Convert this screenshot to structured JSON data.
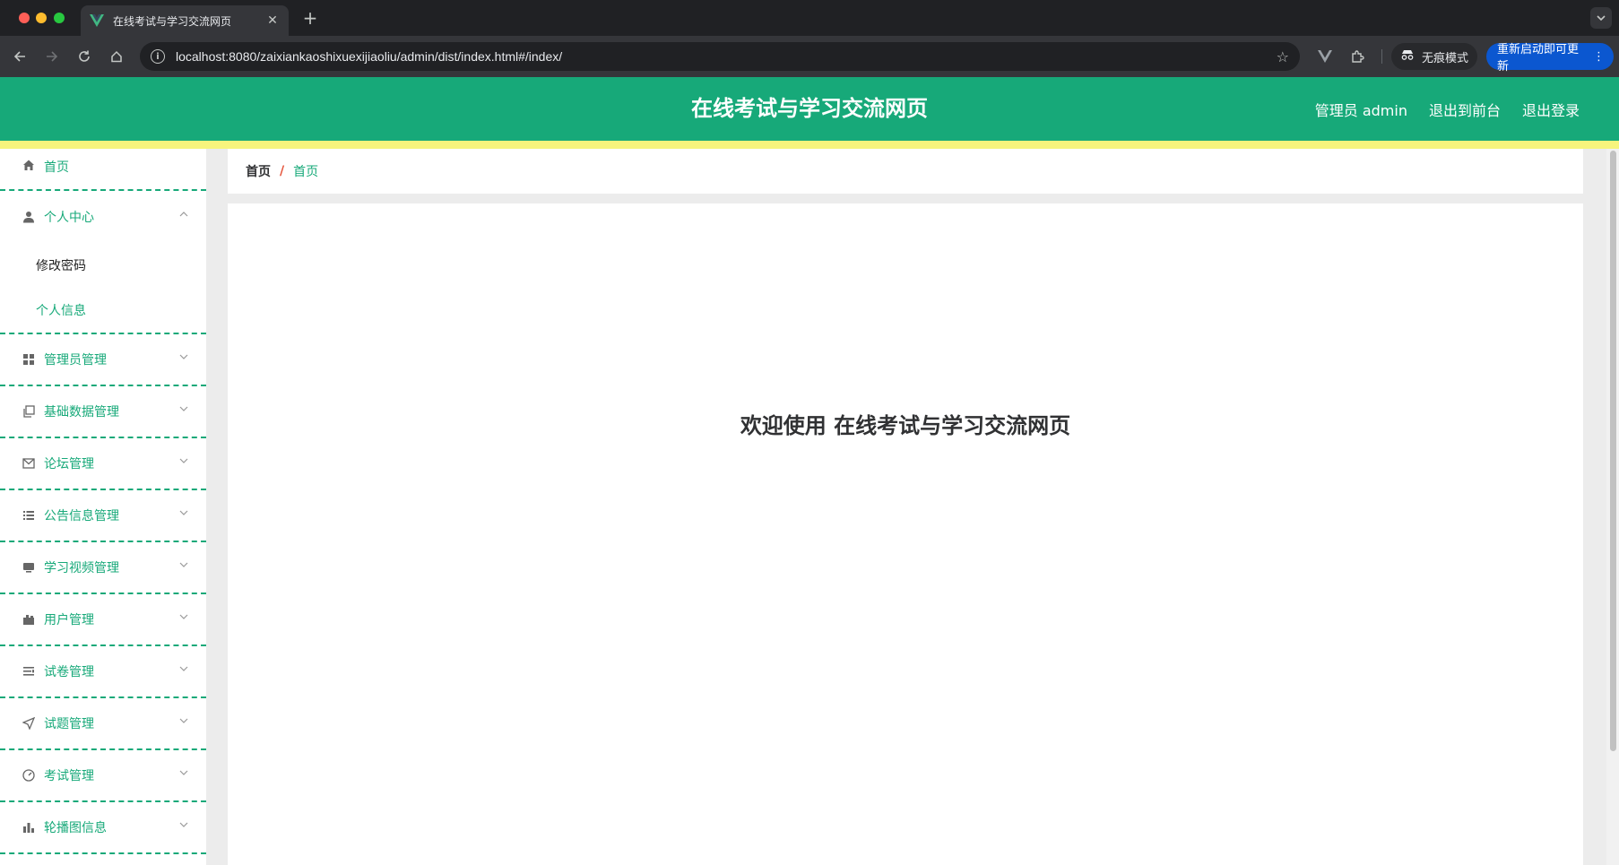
{
  "browser": {
    "tab_title": "在线考试与学习交流网页",
    "url": "localhost:8080/zaixiankaoshixuexijiaoliu/admin/dist/index.html#/index/",
    "incognito_label": "无痕模式",
    "update_label": "重新启动即可更新"
  },
  "header": {
    "title": "在线考试与学习交流网页",
    "user_label": "管理员 admin",
    "front_label": "退出到前台",
    "logout_label": "退出登录"
  },
  "sidebar": {
    "home": "首页",
    "personal": {
      "label": "个人中心",
      "items": [
        "修改密码",
        "个人信息"
      ]
    },
    "items": [
      {
        "label": "管理员管理",
        "icon": "grid-icon"
      },
      {
        "label": "基础数据管理",
        "icon": "copy-icon"
      },
      {
        "label": "论坛管理",
        "icon": "mail-icon"
      },
      {
        "label": "公告信息管理",
        "icon": "list-icon"
      },
      {
        "label": "学习视频管理",
        "icon": "monitor-icon"
      },
      {
        "label": "用户管理",
        "icon": "briefcase-icon"
      },
      {
        "label": "试卷管理",
        "icon": "sliders-icon"
      },
      {
        "label": "试题管理",
        "icon": "send-icon"
      },
      {
        "label": "考试管理",
        "icon": "gauge-icon"
      },
      {
        "label": "轮播图信息",
        "icon": "bar-chart-icon"
      }
    ]
  },
  "breadcrumb": {
    "home": "首页",
    "separator": "/",
    "current": "首页"
  },
  "main": {
    "welcome": "欢迎使用 在线考试与学习交流网页"
  },
  "colors": {
    "primary": "#17a979",
    "accent_strip": "#f7f47d",
    "breadcrumb_sep": "#e5533a"
  }
}
